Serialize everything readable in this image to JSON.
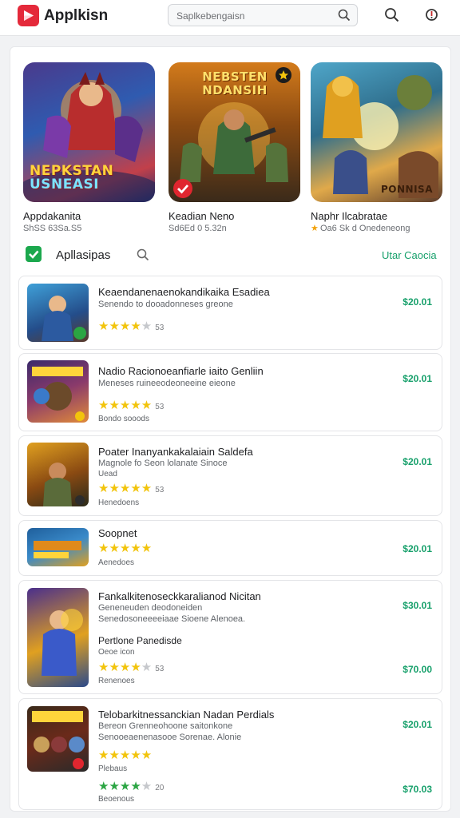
{
  "topbar": {
    "app_name": "Applkisn",
    "search_placeholder": "Saplkebengaisn",
    "logo_icon": "play-icon"
  },
  "featured": [
    {
      "art_title": "NEPKSTAN\nUSNEASI",
      "name": "Appdakanita",
      "sub": "ShSS 63Sa.S5"
    },
    {
      "art_title": "NEBSTEN\nNDANSIH",
      "name": "Keadian Neno",
      "sub": "Sd6Ed 0 5.32n"
    },
    {
      "art_title": "PONNISA",
      "name": "Naphr Ilcabratae",
      "sub": "Oa6 Sk d Onedeneong"
    }
  ],
  "section": {
    "title": "Apllasipas",
    "link": "Utar Caocia"
  },
  "items": [
    {
      "title": "Keaendanenaenokandikaika Esadiea",
      "sub": "Senendo to dooadonneses greone",
      "meta": "",
      "extra": "",
      "rating": 4,
      "count": "53",
      "price": "$20.01"
    },
    {
      "title": "Nadio Racionoeanfiarle iaito Genliin",
      "sub": "Meneses ruineeodeoneeine eieone",
      "meta": "Bondo sooods",
      "extra": "",
      "rating": 5,
      "count": "53",
      "price": "$20.01"
    },
    {
      "title": "Poater Inanyankakalaiain Saldefa",
      "sub": "Magnole fo Seon lolanate Sinoce",
      "meta": "Henedoens",
      "extra": "Uead",
      "rating": 5,
      "count": "53",
      "price": "$20.01"
    },
    {
      "title": "Soopnet",
      "sub": "",
      "meta": "Aenedoes",
      "extra": "",
      "rating": 5,
      "count": "",
      "price": "$20.01"
    },
    {
      "title": "Fankalkitenoseckkaralianod Nicitan",
      "sub": "Geneneuden deodoneiden",
      "meta": "Renenoes",
      "extra": "Oeoe icon",
      "subtitle2": "Senedosoneeeeiaae Sioene Alenoea.",
      "line4": "Pertlone Panedisde",
      "rating": 4,
      "count": "53",
      "price": "$30.01",
      "price2": "$70.00"
    },
    {
      "title": "Telobarkitnessanckian Nadan Perdials",
      "sub": "Bereon Grenneohoone saitonkone",
      "sub2": "Senooeaenenasooe Sorenae. Alonie",
      "meta": "Plebaus",
      "meta2": "Beoenous",
      "rating": 5,
      "count": "",
      "rating2": 4,
      "count2": "20",
      "price": "$20.01",
      "price2": "$70.03"
    }
  ],
  "colors": {
    "accent": "#17a06b",
    "logo": "#e4293a",
    "star": "#f2c40c",
    "check": "#1ba84d"
  }
}
